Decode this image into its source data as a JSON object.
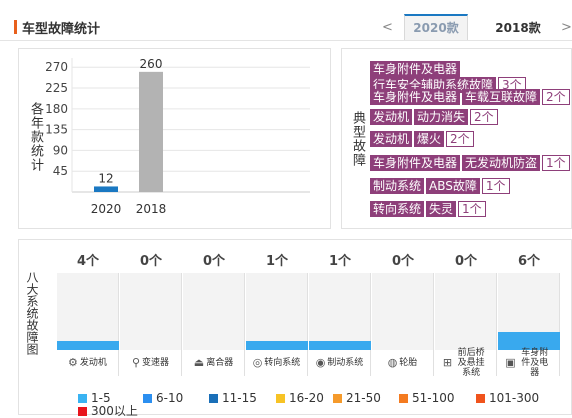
{
  "header": {
    "title": "车型故障统计",
    "prev_arrow": "<",
    "next_arrow": ">",
    "tabs": [
      {
        "label": "2020款",
        "active": true
      },
      {
        "label": "2018款",
        "active": false
      }
    ]
  },
  "colors": {
    "accent": "#e8601c",
    "tab_active": "#1a78c2",
    "issue_tag": "#8e3f7a"
  },
  "chart_data": {
    "type": "bar",
    "ylabel": "各年款统计",
    "categories": [
      "2020",
      "2018"
    ],
    "values": [
      12,
      260
    ],
    "ylim": [
      0,
      290
    ],
    "yticks": [
      45,
      90,
      135,
      180,
      225,
      270
    ],
    "bar_colors": [
      "#1a78c2",
      "#b3b3b3"
    ],
    "grid": true
  },
  "issues_panel": {
    "label": "典型故障",
    "items": [
      {
        "category": "车身附件及电器",
        "issue": "行车安全辅助系统故障",
        "count": "3个"
      },
      {
        "category": "车身附件及电器",
        "issue": "车载互联故障",
        "count": "2个"
      },
      {
        "category": "发动机",
        "issue": "动力消失",
        "count": "2个"
      },
      {
        "category": "发动机",
        "issue": "爆火",
        "count": "2个"
      },
      {
        "category": "车身附件及电器",
        "issue": "无发动机防盗",
        "count": "1个"
      },
      {
        "category": "制动系统",
        "issue": "ABS故障",
        "count": "1个"
      },
      {
        "category": "转向系统",
        "issue": "失灵",
        "count": "1个"
      }
    ]
  },
  "systems_panel": {
    "label": "八大系统故障图",
    "systems": [
      {
        "name": "发动机",
        "count": "4个",
        "level": 0.12,
        "icon": "engine-icon",
        "glyph": "⚙"
      },
      {
        "name": "变速器",
        "count": "0个",
        "level": 0,
        "icon": "gear-shift-icon",
        "glyph": "⚲"
      },
      {
        "name": "离合器",
        "count": "0个",
        "level": 0,
        "icon": "clutch-pedal-icon",
        "glyph": "⏏"
      },
      {
        "name": "转向系统",
        "count": "1个",
        "level": 0.12,
        "icon": "steering-wheel-icon",
        "glyph": "◎"
      },
      {
        "name": "制动系统",
        "count": "1个",
        "level": 0.12,
        "icon": "brake-icon",
        "glyph": "◉"
      },
      {
        "name": "轮胎",
        "count": "0个",
        "level": 0,
        "icon": "tire-icon",
        "glyph": "◍"
      },
      {
        "name": "前后桥及悬挂系统",
        "count": "0个",
        "level": 0,
        "icon": "suspension-icon",
        "glyph": "⊞"
      },
      {
        "name": "车身附件及电器",
        "count": "6个",
        "level": 0.24,
        "icon": "car-body-icon",
        "glyph": "▣"
      }
    ]
  },
  "legend": [
    {
      "label": "1-5",
      "color": "#39b3f2"
    },
    {
      "label": "6-10",
      "color": "#2b8ff0"
    },
    {
      "label": "11-15",
      "color": "#1a6fb8"
    },
    {
      "label": "16-20",
      "color": "#f7c325"
    },
    {
      "label": "21-50",
      "color": "#f59a2b"
    },
    {
      "label": "51-100",
      "color": "#f47b20"
    },
    {
      "label": "101-300",
      "color": "#f0531c"
    },
    {
      "label": "300以上",
      "color": "#e8141c"
    }
  ]
}
